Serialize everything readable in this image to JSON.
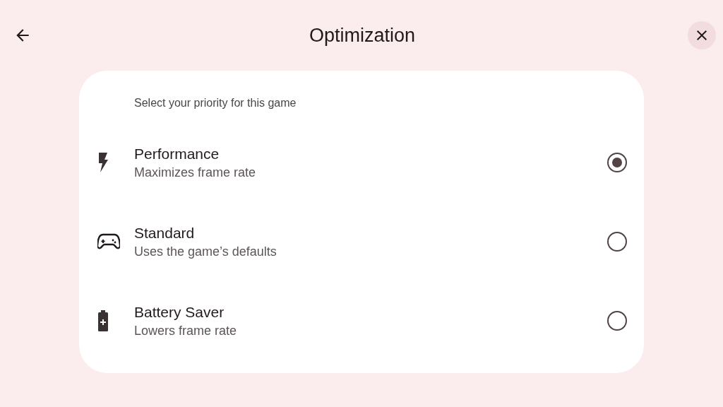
{
  "header": {
    "title": "Optimization"
  },
  "card": {
    "heading": "Select your priority for this game",
    "options": [
      {
        "kind": "bolt",
        "label": "Performance",
        "description": "Maximizes frame rate",
        "selected": true
      },
      {
        "kind": "gamepad",
        "label": "Standard",
        "description": "Uses the game’s defaults",
        "selected": false
      },
      {
        "kind": "battery",
        "label": "Battery Saver",
        "description": "Lowers frame rate",
        "selected": false
      }
    ]
  }
}
